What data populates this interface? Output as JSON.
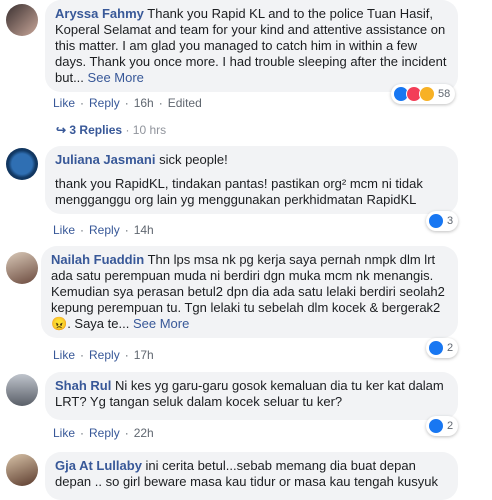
{
  "comments": [
    {
      "author": "Aryssa Fahmy",
      "text": "Thank you Rapid KL and to the police Tuan Hasif, Koperal Selamat and team for your kind and attentive assistance on this matter. I am glad you managed to catch him in within a few days. Thank you once more. I had trouble sleeping after the incident but...",
      "see_more": "See More",
      "like_label": "Like",
      "reply_label": "Reply",
      "time": "16h",
      "edited": "Edited",
      "reaction_count": "58",
      "replies_label": "3 Replies",
      "replies_time": "10 hrs"
    },
    {
      "author": "Juliana Jasmani",
      "line1": "sick people!",
      "line2": "thank you RapidKL, tindakan pantas! pastikan org² mcm ni tidak mengganggu org lain yg menggunakan perkhidmatan RapidKL",
      "like_label": "Like",
      "reply_label": "Reply",
      "time": "14h",
      "reaction_count": "3"
    },
    {
      "author": "Nailah Fuaddin",
      "text": "Thn lps msa nk pg kerja saya pernah nmpk dlm lrt ada satu perempuan muda ni berdiri dgn muka mcm nk menangis. Kemudian sya perasan betul2 dpn dia ada satu lelaki berdiri seolah2 kepung perempuan tu. Tgn lelaki tu sebelah dlm kocek & bergerak2",
      "emoji": "😠",
      "text_tail": ". Saya te...",
      "see_more": "See More",
      "like_label": "Like",
      "reply_label": "Reply",
      "time": "17h",
      "reaction_count": "2"
    },
    {
      "author": "Shah Rul",
      "text": "Ni kes yg garu-garu gosok kemaluan dia tu ker kat dalam LRT? Yg tangan seluk dalam kocek seluar tu ker?",
      "like_label": "Like",
      "reply_label": "Reply",
      "time": "22h",
      "reaction_count": "2"
    },
    {
      "author": "Gja At Lullaby",
      "text": "ini cerita betul...sebab memang dia buat depan depan .. so girl beware masa kau tidur or masa kau tengah kusyuk"
    }
  ],
  "colors": {
    "link": "#385898",
    "bubble": "#f2f3f5",
    "like": "#1877f2",
    "love": "#f33e58",
    "wow": "#f7b125"
  }
}
